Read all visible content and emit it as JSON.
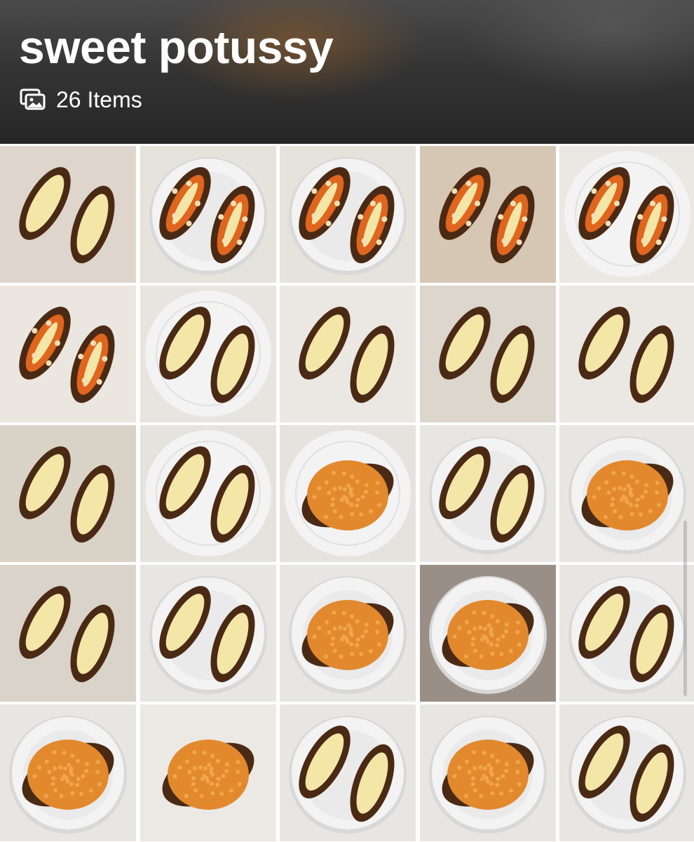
{
  "album": {
    "title": "sweet potussy",
    "count_label": "26 Items",
    "count_icon": "photo-stack-icon"
  },
  "colors": {
    "skin": "#4a2a14",
    "cheese": "#f4e6a6",
    "orange": "#e0651e",
    "pasta": "#e2892e",
    "plate": "#f3f3f3",
    "background": "#ffffff"
  },
  "photos": [
    {
      "bg": "#ded6cc",
      "plate": null,
      "items": [
        "potato",
        "potato"
      ],
      "topping": "cheese"
    },
    {
      "bg": "#e6e2dc",
      "plate": "bowl",
      "items": [
        "potato",
        "potato"
      ],
      "topping": "stars"
    },
    {
      "bg": "#e6e2dc",
      "plate": "bowl",
      "items": [
        "potato",
        "potato"
      ],
      "topping": "stars"
    },
    {
      "bg": "#d6c7b5",
      "plate": null,
      "items": [
        "potato",
        "potato"
      ],
      "topping": "stars"
    },
    {
      "bg": "#ebe8e4",
      "plate": "plate",
      "items": [
        "potato",
        "potato"
      ],
      "topping": "stars"
    },
    {
      "bg": "#ebe6df",
      "plate": null,
      "items": [
        "potato",
        "potato"
      ],
      "topping": "stars"
    },
    {
      "bg": "#e8e4e0",
      "plate": "plate",
      "items": [
        "potato",
        "potato"
      ],
      "topping": "cheese"
    },
    {
      "bg": "#ebe8e4",
      "plate": null,
      "items": [
        "potato",
        "potato"
      ],
      "topping": "cheese"
    },
    {
      "bg": "#dcd6cd",
      "plate": null,
      "items": [
        "potato",
        "potato"
      ],
      "topping": "cheese"
    },
    {
      "bg": "#ebe8e4",
      "plate": null,
      "items": [
        "potato",
        "potato"
      ],
      "topping": "cheese"
    },
    {
      "bg": "#d9d2c7",
      "plate": null,
      "items": [
        "potato",
        "potato"
      ],
      "topping": "cheese"
    },
    {
      "bg": "#e6e3df",
      "plate": "plate",
      "items": [
        "potato",
        "potato"
      ],
      "topping": "cheese"
    },
    {
      "bg": "#e6e3df",
      "plate": "plate",
      "items": [
        "potato"
      ],
      "topping": "pasta"
    },
    {
      "bg": "#e8e6e3",
      "plate": "bowl",
      "items": [
        "potato",
        "potato"
      ],
      "topping": "cheese"
    },
    {
      "bg": "#e8e6e3",
      "plate": "bowl",
      "items": [
        "potato"
      ],
      "topping": "pasta"
    },
    {
      "bg": "#d9d3ca",
      "plate": null,
      "items": [
        "potato",
        "potato"
      ],
      "topping": "cheese"
    },
    {
      "bg": "#e8e6e3",
      "plate": "bowl",
      "items": [
        "potato",
        "potato"
      ],
      "topping": "cheese"
    },
    {
      "bg": "#e8e6e3",
      "plate": "bowl",
      "items": [
        "potato"
      ],
      "topping": "pasta"
    },
    {
      "bg": "#9a8f86",
      "plate": "bowl",
      "items": [
        "potato"
      ],
      "topping": "pasta"
    },
    {
      "bg": "#e8e6e3",
      "plate": "bowl",
      "items": [
        "potato",
        "potato"
      ],
      "topping": "cheese"
    },
    {
      "bg": "#e8e6e3",
      "plate": "bowl",
      "items": [
        "potato"
      ],
      "topping": "pasta"
    },
    {
      "bg": "#ece9e4",
      "plate": null,
      "items": [
        "potato"
      ],
      "topping": "pasta"
    },
    {
      "bg": "#e8e6e3",
      "plate": "bowl",
      "items": [
        "potato",
        "potato"
      ],
      "topping": "cheese"
    },
    {
      "bg": "#e8e6e3",
      "plate": "bowl",
      "items": [
        "potato"
      ],
      "topping": "pasta"
    },
    {
      "bg": "#e8e6e3",
      "plate": "bowl",
      "items": [
        "potato",
        "potato"
      ],
      "topping": "cheese"
    }
  ]
}
